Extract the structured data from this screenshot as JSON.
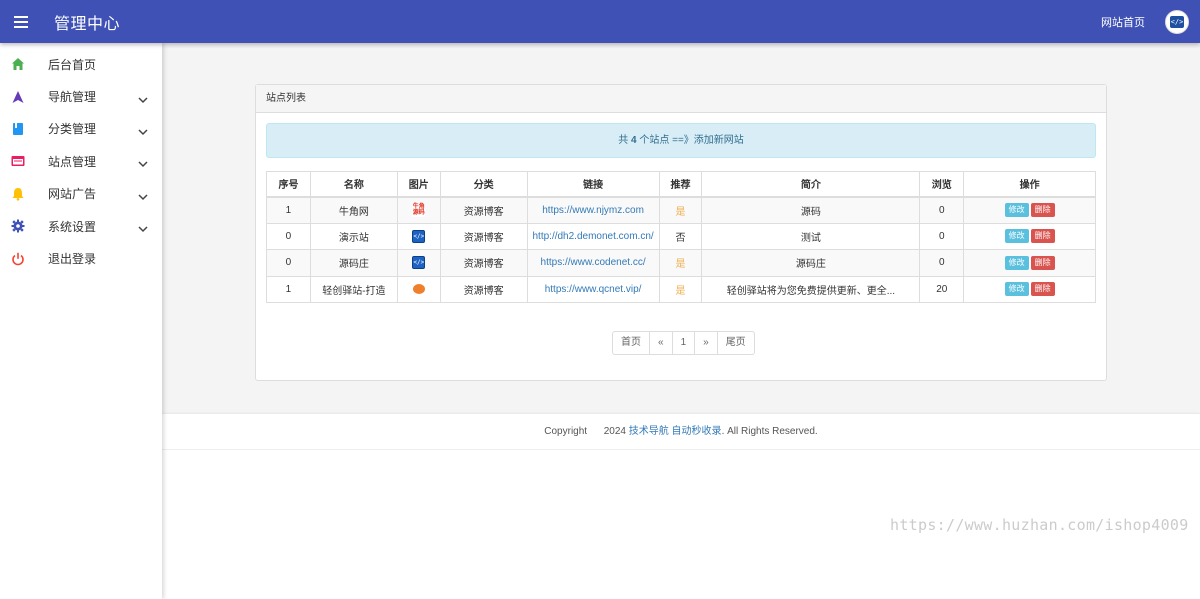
{
  "header": {
    "title": "管理中心",
    "site_home": "网站首页",
    "menu_icon": "hamburger-icon",
    "avatar_icon": "code-logo-icon",
    "avatar_text": "</>"
  },
  "sidebar": {
    "items": [
      {
        "label": "后台首页",
        "icon": "home-icon",
        "color": "#4caf50",
        "expandable": false
      },
      {
        "label": "导航管理",
        "icon": "navigation-icon",
        "color": "#673ab7",
        "expandable": true
      },
      {
        "label": "分类管理",
        "icon": "bookmark-icon",
        "color": "#2196f3",
        "expandable": true
      },
      {
        "label": "站点管理",
        "icon": "browser-window-icon",
        "color": "#e91e63",
        "expandable": true
      },
      {
        "label": "网站广告",
        "icon": "bell-icon",
        "color": "#ffc107",
        "expandable": true
      },
      {
        "label": "系统设置",
        "icon": "gear-icon",
        "color": "#3f51b5",
        "expandable": true
      },
      {
        "label": "退出登录",
        "icon": "power-icon",
        "color": "#f44336",
        "expandable": false
      }
    ]
  },
  "panel": {
    "title": "站点列表",
    "alert": {
      "prefix": "共 ",
      "count": "4",
      "suffix": " 个站点 ==》",
      "link": "添加新网站"
    },
    "columns": [
      "序号",
      "名称",
      "图片",
      "分类",
      "链接",
      "推荐",
      "简介",
      "浏览",
      "操作"
    ],
    "rows": [
      {
        "order": "1",
        "name": "牛角网",
        "image": "red-logo-icon",
        "image_text": "牛角\n源码",
        "category": "资源博客",
        "link": "https://www.njymz.com",
        "recommend": "是",
        "desc": "源码",
        "views": "0",
        "edit": "修改",
        "del": "删除"
      },
      {
        "order": "0",
        "name": "演示站",
        "image": "code-logo-icon",
        "image_text": "</>",
        "category": "资源博客",
        "link": "http://dh2.demonet.com.cn/",
        "recommend": "否",
        "desc": "测试",
        "views": "0",
        "edit": "修改",
        "del": "删除"
      },
      {
        "order": "0",
        "name": "源码庄",
        "image": "code-logo-icon",
        "image_text": "</>",
        "category": "资源博客",
        "link": "https://www.codenet.cc/",
        "recommend": "是",
        "desc": "源码庄",
        "views": "0",
        "edit": "修改",
        "del": "删除"
      },
      {
        "order": "1",
        "name": "轻创驿站-打造",
        "image": "orange-logo-icon",
        "image_text": "",
        "category": "资源博客",
        "link": "https://www.qcnet.vip/",
        "recommend": "是",
        "desc": "轻创驿站将为您免费提供更新、更全...",
        "views": "20",
        "edit": "修改",
        "del": "删除"
      }
    ],
    "pagination": [
      "首页",
      "«",
      "1",
      "»",
      "尾页"
    ]
  },
  "footer": {
    "copyright": "Copyright",
    "year": "2024",
    "link": "技术导航 自动秒收录",
    "rights": ". All Rights Reserved."
  },
  "watermark": "https://www.huzhan.com/ishop4009",
  "colors": {
    "header_bg": "#3f51b5",
    "alert_bg": "#d9edf7",
    "edit_btn": "#5bc0de",
    "delete_btn": "#d9534f",
    "recommend_yes": "#f0ad4e",
    "link": "#337ab7"
  }
}
